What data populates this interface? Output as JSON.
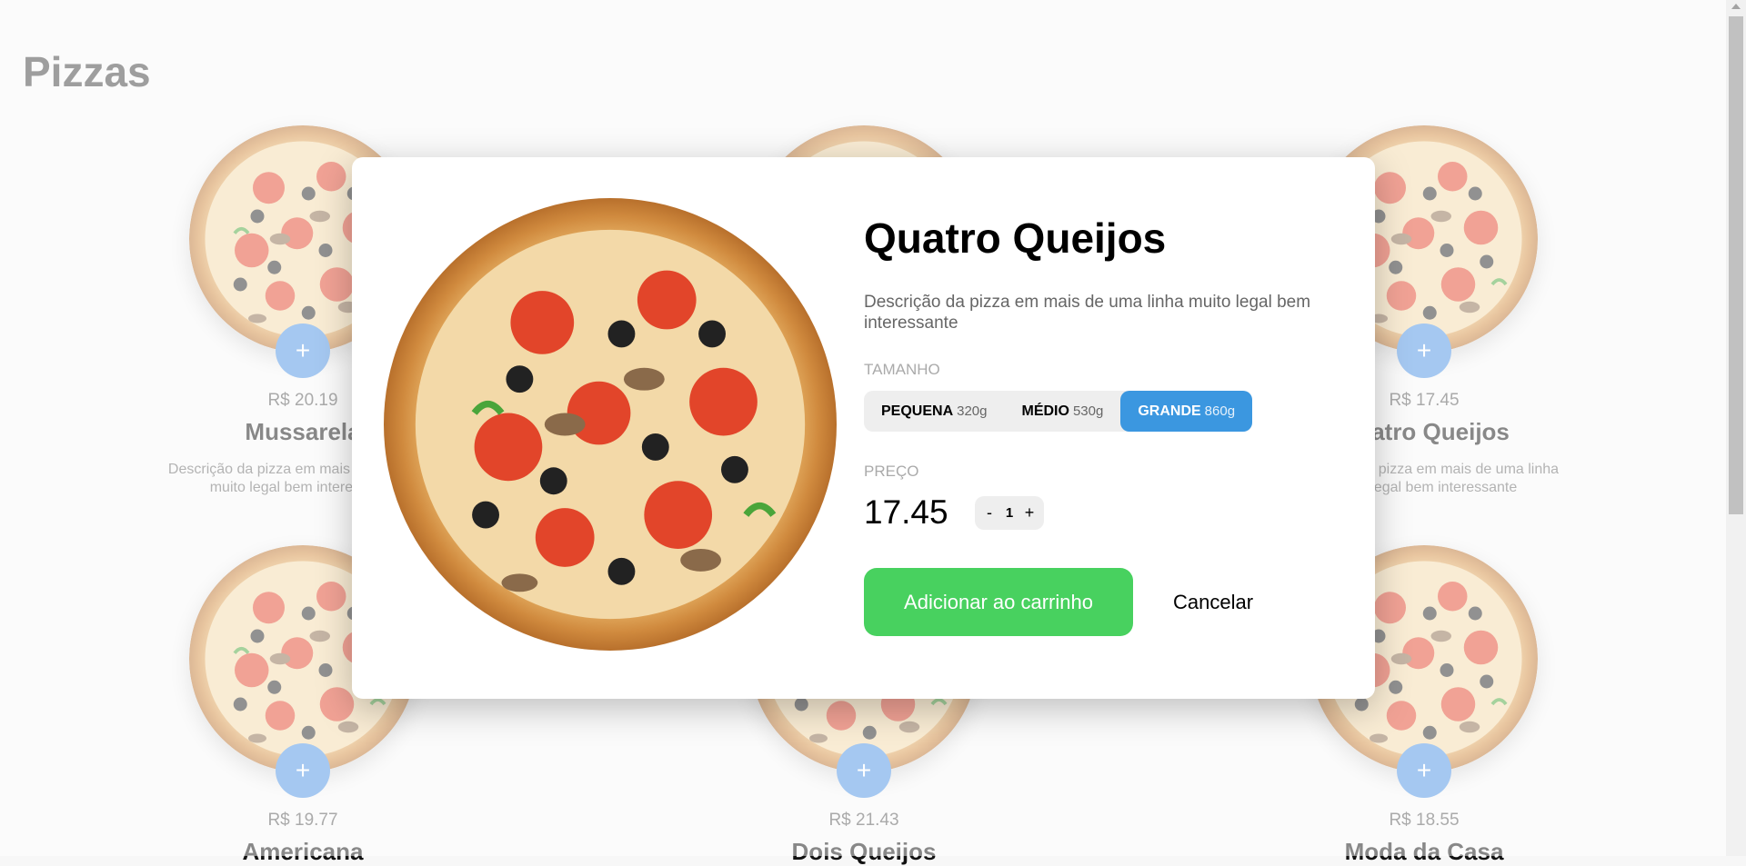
{
  "page": {
    "title": "Pizzas"
  },
  "pizzas": [
    {
      "price": "R$ 20.19",
      "name": "Mussarela",
      "desc": "Descrição da pizza em mais de uma linha muito legal bem interessante"
    },
    {
      "price": "",
      "name": "",
      "desc": ""
    },
    {
      "price": "R$ 17.45",
      "name": "Quatro Queijos",
      "desc": "Descrição da pizza em mais de uma linha muito legal bem interessante"
    },
    {
      "price": "R$ 19.77",
      "name": "Americana",
      "desc": ""
    },
    {
      "price": "R$ 21.43",
      "name": "Dois Queijos",
      "desc": ""
    },
    {
      "price": "R$ 18.55",
      "name": "Moda da Casa",
      "desc": ""
    }
  ],
  "card": {
    "add_label": "+"
  },
  "modal": {
    "title": "Quatro Queijos",
    "description": "Descrição da pizza em mais de uma linha muito legal bem interessante",
    "size_label": "TAMANHO",
    "sizes": [
      {
        "name": "PEQUENA",
        "weight": "320g"
      },
      {
        "name": "MÉDIO",
        "weight": "530g"
      },
      {
        "name": "GRANDE",
        "weight": "860g"
      }
    ],
    "selected_size": "GRANDE",
    "price_label": "PREÇO",
    "price": "17.45",
    "qty_minus": "-",
    "qty_value": "1",
    "qty_plus": "+",
    "add_to_cart": "Adicionar ao carrinho",
    "cancel": "Cancelar"
  },
  "colors": {
    "accent": "#3b97e0",
    "cart": "#48d15f",
    "add_button": "#4a90e2"
  }
}
